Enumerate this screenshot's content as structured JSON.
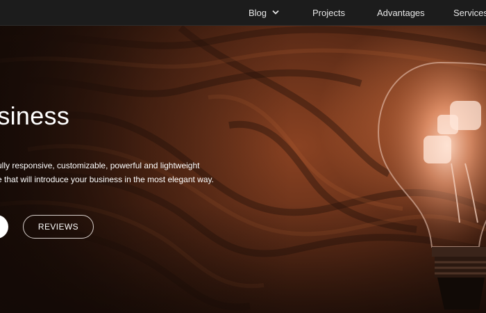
{
  "nav": {
    "items": [
      {
        "label": "Blog",
        "has_dropdown": true
      },
      {
        "label": "Projects"
      },
      {
        "label": "Advantages"
      },
      {
        "label": "Services"
      }
    ]
  },
  "hero": {
    "title": "usiness",
    "description_lines": [
      "ully responsive, customizable, powerful and lightweight",
      "e that will introduce your business in the most elegant way."
    ],
    "secondary_button_label": "REVIEWS"
  },
  "colors": {
    "navbar_bg": "#1c1c1c",
    "accent_glow": "#e07a45",
    "text": "#ffffff"
  },
  "icons": {
    "dropdown": "chevron-down-icon"
  }
}
